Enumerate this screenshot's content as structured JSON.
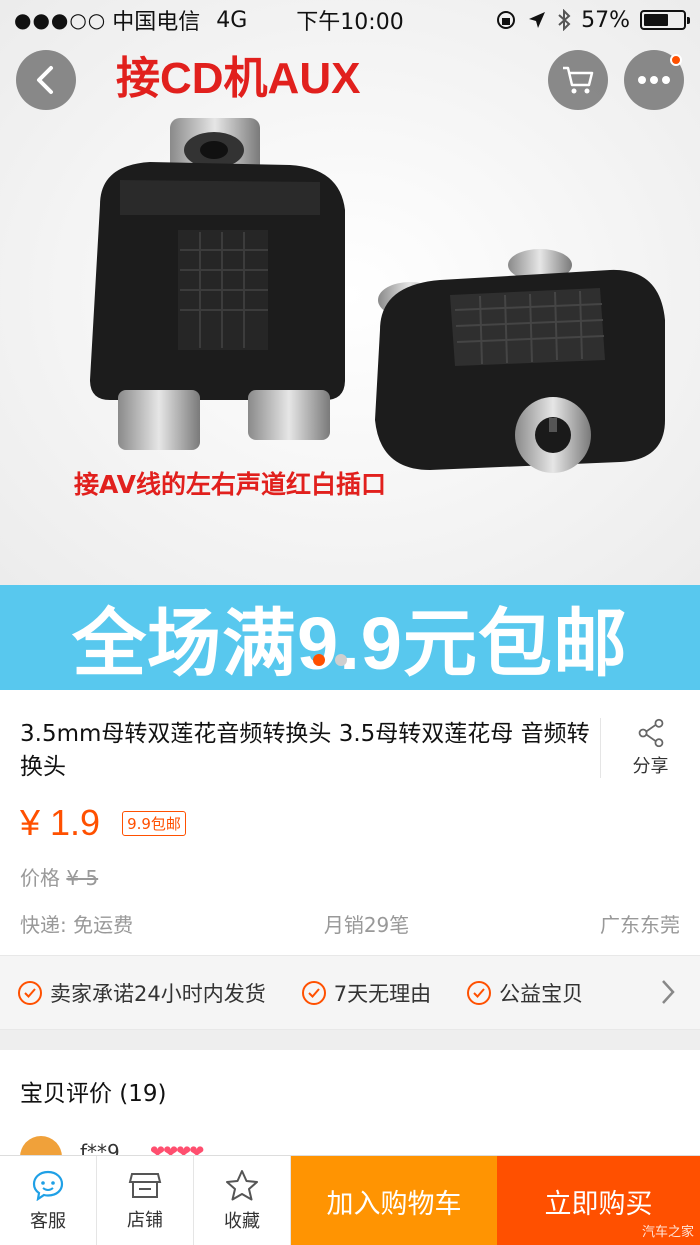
{
  "status_bar": {
    "signal_dots": "●●●○○",
    "carrier": "中国电信",
    "network": "4G",
    "time": "下午10:00",
    "battery_percent": "57%"
  },
  "hero": {
    "title_overlay": "接CD机AUX",
    "caption_overlay": "接AV线的左右声道红白插口",
    "promo_text": "全场满9.9元包邮",
    "carousel": {
      "count": 2,
      "active_index": 0
    }
  },
  "nav": {
    "back_icon": "chevron-left-icon",
    "cart_icon": "cart-icon",
    "more_icon": "more-icon"
  },
  "product": {
    "title": "3.5mm母转双莲花音频转换头 3.5母转双莲花母 音频转换头",
    "share_label": "分享",
    "price": "¥ 1.9",
    "tag": "9.9包邮",
    "original_price_label": "价格",
    "original_price": "¥ 5",
    "shipping": "快递: 免运费",
    "monthly_sales": "月销29笔",
    "location": "广东东莞"
  },
  "promises": [
    "卖家承诺24小时内发货",
    "7天无理由",
    "公益宝贝"
  ],
  "reviews": {
    "title": "宝贝评价 (19)",
    "first_user": "f**9",
    "first_hearts": "❤❤❤❤"
  },
  "bottom_bar": {
    "service_label": "客服",
    "shop_label": "店铺",
    "favorite_label": "收藏",
    "add_to_cart_label": "加入购物车",
    "buy_now_label": "立即购买",
    "watermark": "汽车之家"
  },
  "colors": {
    "accent": "#ff5000",
    "cart_orange": "#ff9402",
    "banner_blue": "#58c8ee",
    "image_text_red": "#e1201d"
  }
}
